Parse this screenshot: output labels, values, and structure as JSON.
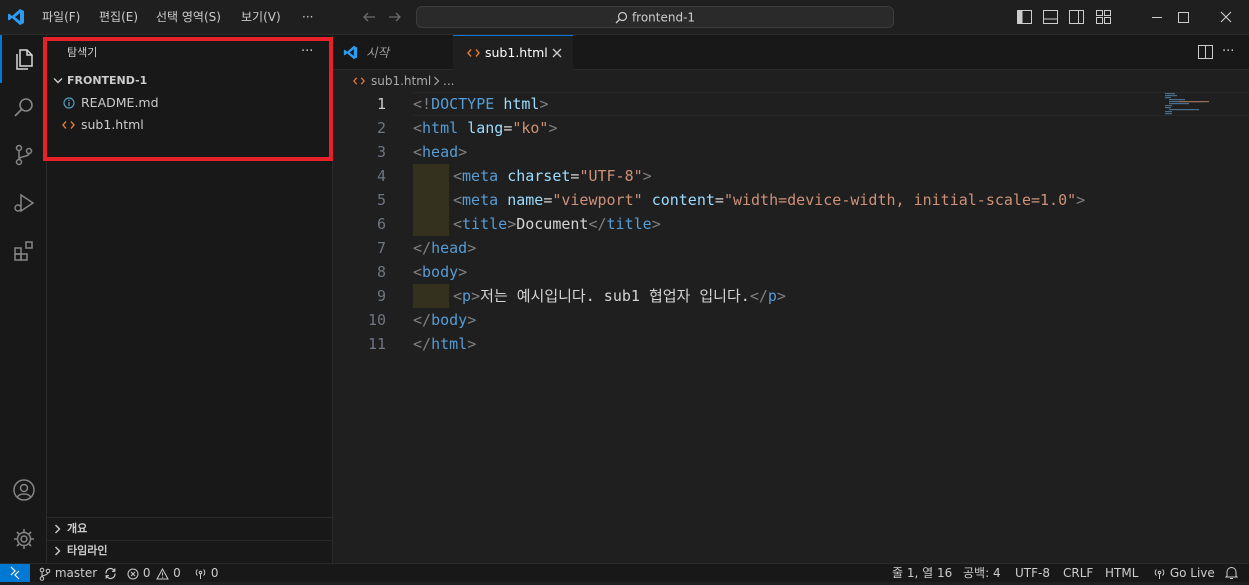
{
  "menu": {
    "file": "파일(F)",
    "edit": "편집(E)",
    "selection": "선택 영역(S)",
    "view": "보기(V)",
    "more": "···"
  },
  "search": {
    "text": "frontend-1"
  },
  "sidebar": {
    "title": "탐색기",
    "more": "···",
    "folder": "FRONTEND-1",
    "files": [
      {
        "name": "README.md",
        "icon": "info-icon"
      },
      {
        "name": "sub1.html",
        "icon": "html-icon"
      }
    ],
    "outline": "개요",
    "timeline": "타임라인"
  },
  "tabs": [
    {
      "label": "시작",
      "active": false
    },
    {
      "label": "sub1.html",
      "active": true
    }
  ],
  "breadcrumb": {
    "file": "sub1.html",
    "rest": "..."
  },
  "editor": {
    "line_numbers": [
      "1",
      "2",
      "3",
      "4",
      "5",
      "6",
      "7",
      "8",
      "9",
      "10",
      "11"
    ],
    "current_line": 1,
    "code": {
      "l1": {
        "a": "<!",
        "b": "DOCTYPE",
        "c": " ",
        "d": "html",
        "e": ">"
      },
      "l2": {
        "a": "<",
        "b": "html",
        "c": " ",
        "d": "lang",
        "e": "=",
        "f": "\"ko\"",
        "g": ">"
      },
      "l3": {
        "a": "<",
        "b": "head",
        "c": ">"
      },
      "l4": {
        "a": "<",
        "b": "meta",
        "c": " ",
        "d": "charset",
        "e": "=",
        "f": "\"UTF-8\"",
        "g": ">"
      },
      "l5": {
        "a": "<",
        "b": "meta",
        "c": " ",
        "d": "name",
        "e": "=",
        "f": "\"viewport\"",
        "g": " ",
        "h": "content",
        "i": "=",
        "j": "\"width=device-width, initial-scale=1.0\"",
        "k": ">"
      },
      "l6": {
        "a": "<",
        "b": "title",
        "c": ">",
        "d": "Document",
        "e": "</",
        "f": "title",
        "g": ">"
      },
      "l7": {
        "a": "</",
        "b": "head",
        "c": ">"
      },
      "l8": {
        "a": "<",
        "b": "body",
        "c": ">"
      },
      "l9": {
        "a": "<",
        "b": "p",
        "c": ">",
        "d": "저는 예시입니다. sub1 협업자 입니다.",
        "e": "</",
        "f": "p",
        "g": ">"
      },
      "l10": {
        "a": "</",
        "b": "body",
        "c": ">"
      },
      "l11": {
        "a": "</",
        "b": "html",
        "c": ">"
      }
    }
  },
  "status": {
    "branch": "master",
    "errors": "0",
    "warnings": "0",
    "ports": "0",
    "position": "줄 1, 열 16",
    "spaces": "공백: 4",
    "encoding": "UTF-8",
    "eol": "CRLF",
    "language": "HTML",
    "golive": "Go Live"
  },
  "colors": {
    "highlight_box": "#e8202a",
    "accent": "#0078d4"
  }
}
